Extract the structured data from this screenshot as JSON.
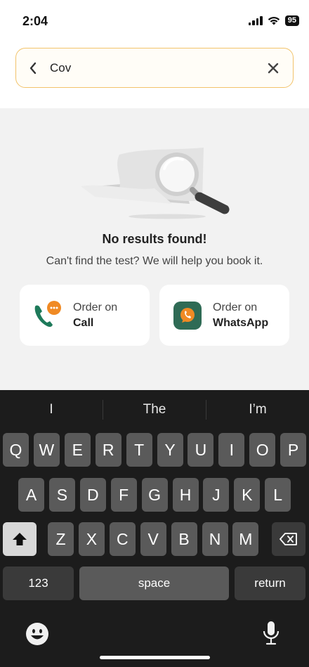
{
  "status": {
    "time": "2:04",
    "battery": "95"
  },
  "search": {
    "value": "Cov",
    "placeholder": ""
  },
  "empty_state": {
    "title": "No results found!",
    "subtitle": "Can't find the test? We will help you book it."
  },
  "order_options": [
    {
      "line1": "Order on",
      "line2": "Call",
      "icon": "phone-chat-icon"
    },
    {
      "line1": "Order on",
      "line2": "WhatsApp",
      "icon": "whatsapp-icon"
    }
  ],
  "keyboard": {
    "suggestions": [
      "I",
      "The",
      "I’m"
    ],
    "row1": [
      "Q",
      "W",
      "E",
      "R",
      "T",
      "Y",
      "U",
      "I",
      "O",
      "P"
    ],
    "row2": [
      "A",
      "S",
      "D",
      "F",
      "G",
      "H",
      "J",
      "K",
      "L"
    ],
    "row3": [
      "Z",
      "X",
      "C",
      "V",
      "B",
      "N",
      "M"
    ],
    "numbers_key": "123",
    "space_key": "space",
    "return_key": "return"
  },
  "colors": {
    "search_border": "#f2c36b",
    "call_icon_green": "#1e7a5a",
    "chat_badge_orange": "#f08a24"
  }
}
